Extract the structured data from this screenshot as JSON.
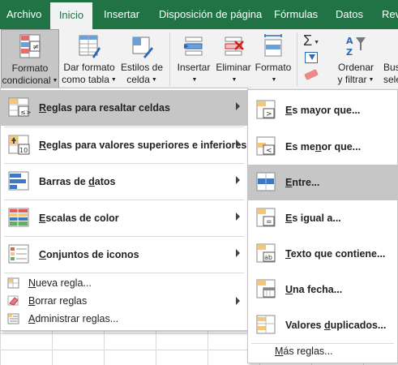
{
  "tabs": [
    {
      "label": "Archivo"
    },
    {
      "label": "Inicio"
    },
    {
      "label": "Insertar"
    },
    {
      "label": "Disposición de página"
    },
    {
      "label": "Fórmulas"
    },
    {
      "label": "Datos"
    },
    {
      "label": "Rev"
    }
  ],
  "ribbon": {
    "cond_format": {
      "line1": "Formato",
      "line2": "condicional"
    },
    "format_table": {
      "line1": "Dar formato",
      "line2": "como tabla"
    },
    "cell_styles": {
      "line1": "Estilos de",
      "line2": "celda"
    },
    "insert": {
      "line1": "Insertar"
    },
    "delete": {
      "line1": "Eliminar"
    },
    "format": {
      "line1": "Formato"
    },
    "sort_filter": {
      "line1": "Ordenar",
      "line2": "y filtrar"
    },
    "find_select": {
      "line1": "Bus",
      "line2": "selecc"
    }
  },
  "menu": {
    "items": [
      {
        "pre": "",
        "key": "R",
        "post": "eglas para resaltar celdas"
      },
      {
        "pre": "",
        "key": "R",
        "post": "eglas para valores superiores e inferiores"
      },
      {
        "pre": "Barras de ",
        "key": "d",
        "post": "atos"
      },
      {
        "pre": "",
        "key": "E",
        "post": "scalas de color"
      },
      {
        "pre": "",
        "key": "C",
        "post": "onjuntos de iconos"
      }
    ],
    "small_items": [
      {
        "pre": "",
        "key": "N",
        "post": "ueva regla..."
      },
      {
        "pre": "",
        "key": "B",
        "post": "orrar reglas"
      },
      {
        "pre": "",
        "key": "A",
        "post": "dministrar reglas..."
      }
    ]
  },
  "submenu": {
    "items": [
      {
        "pre": "",
        "key": "E",
        "post": "s mayor que..."
      },
      {
        "pre": "Es me",
        "key": "n",
        "post": "or que..."
      },
      {
        "pre": "",
        "key": "E",
        "post": "ntre..."
      },
      {
        "pre": "",
        "key": "E",
        "post": "s igual a..."
      },
      {
        "pre": "",
        "key": "T",
        "post": "exto que contiene..."
      },
      {
        "pre": "",
        "key": "U",
        "post": "na fecha..."
      },
      {
        "pre": "Valores ",
        "key": "d",
        "post": "uplicados..."
      }
    ],
    "more": {
      "pre": "",
      "key": "M",
      "post": "ás reglas..."
    }
  },
  "colors": {
    "accent": "#217346",
    "highlight": "#c6c6c6"
  }
}
